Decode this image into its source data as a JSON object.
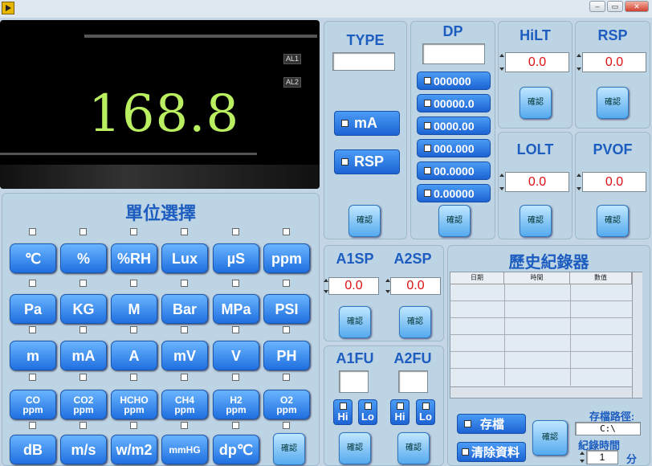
{
  "display": {
    "value": "168.8",
    "alarm1": "AL1",
    "alarm2": "AL2"
  },
  "unit_select": {
    "title": "單位選擇",
    "rows": [
      [
        "℃",
        "%",
        "%RH",
        "Lux",
        "µS",
        "ppm"
      ],
      [
        "Pa",
        "KG",
        "M",
        "Bar",
        "MPa",
        "PSI"
      ],
      [
        "m",
        "mA",
        "A",
        "mV",
        "V",
        "PH"
      ],
      [
        "CO ppm",
        "CO2 ppm",
        "HCHO ppm",
        "CH4 ppm",
        "H2 ppm",
        "O2 ppm"
      ],
      [
        "dB",
        "m/s",
        "w/m2",
        "mmHG",
        "dp℃"
      ]
    ],
    "confirm": "確認"
  },
  "type": {
    "title": "TYPE",
    "value": "",
    "btn_ma": "mA",
    "btn_rsp": "RSP",
    "confirm": "確認"
  },
  "dp": {
    "title": "DP",
    "value": "",
    "options": [
      "000000",
      "00000.0",
      "0000.00",
      "000.000",
      "00.0000",
      "0.00000"
    ],
    "confirm": "確認"
  },
  "hilt": {
    "title": "HiLT",
    "value": "0.0",
    "confirm": "確認"
  },
  "rsp": {
    "title": "RSP",
    "value": "0.0",
    "confirm": "確認"
  },
  "lolt": {
    "title": "LOLT",
    "value": "0.0",
    "confirm": "確認"
  },
  "pvof": {
    "title": "PVOF",
    "value": "0.0",
    "confirm": "確認"
  },
  "a1sp": {
    "title": "A1SP",
    "value": "0.0",
    "confirm": "確認"
  },
  "a2sp": {
    "title": "A2SP",
    "value": "0.0",
    "confirm": "確認"
  },
  "a1fu": {
    "title": "A1FU",
    "hi": "Hi",
    "lo": "Lo",
    "confirm": "確認"
  },
  "a2fu": {
    "title": "A2FU",
    "hi": "Hi",
    "lo": "Lo",
    "confirm": "確認"
  },
  "history": {
    "title": "歷史紀錄器",
    "columns": [
      "日期",
      "時間",
      "數值"
    ],
    "save": "存檔",
    "clear": "清除資料",
    "confirm": "確認",
    "path_label": "存檔路徑:",
    "path_value": "C:\\",
    "interval_label": "紀錄時間",
    "interval_value": "1",
    "interval_unit": "分"
  }
}
